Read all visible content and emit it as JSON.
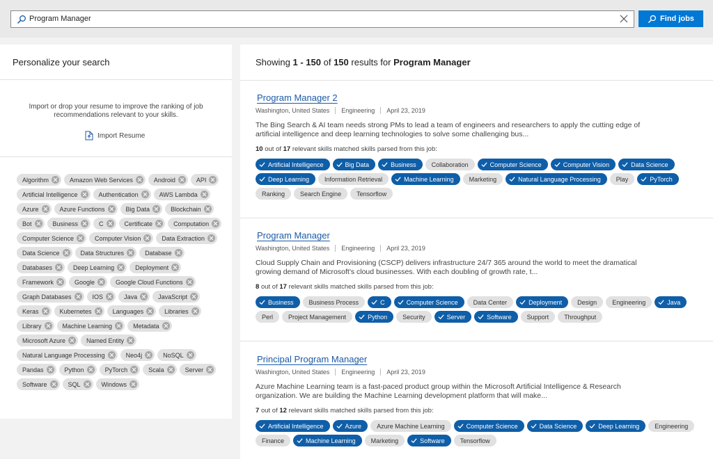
{
  "search": {
    "query": "Program Manager",
    "button_label": "Find jobs"
  },
  "left_panel": {
    "title": "Personalize your search",
    "import_message": "Import or drop your resume to improve the ranking of job recommendations relevant to your skills.",
    "import_label": "Import Resume",
    "skills": [
      "Algorithm",
      "Amazon Web Services",
      "Android",
      "API",
      "Artificial Intelligence",
      "Authentication",
      "AWS Lambda",
      "Azure",
      "Azure Functions",
      "Big Data",
      "Blockchain",
      "Bot",
      "Business",
      "C",
      "Certificate",
      "Computation",
      "Computer Science",
      "Computer Vision",
      "Data Extraction",
      "Data Science",
      "Data Structures",
      "Database",
      "Databases",
      "Deep Learning",
      "Deployment",
      "Framework",
      "Google",
      "Google Cloud Functions",
      "Graph Databases",
      "IOS",
      "Java",
      "JavaScript",
      "Keras",
      "Kubernetes",
      "Languages",
      "Libraries",
      "Library",
      "Machine Learning",
      "Metadata",
      "Microsoft Azure",
      "Named Entity",
      "Natural Language Processing",
      "Neo4j",
      "NoSQL",
      "Pandas",
      "Python",
      "PyTorch",
      "Scala",
      "Server",
      "Software",
      "SQL",
      "Windows"
    ]
  },
  "results": {
    "prefix": "Showing",
    "range": "1 - 150",
    "of": "of",
    "total": "150",
    "results_for": "results for",
    "query": "Program Manager"
  },
  "jobs": [
    {
      "title": "Program Manager 2",
      "location": "Washington, United States",
      "category": "Engineering",
      "date": "April 23, 2019",
      "description": "The Bing Search & AI team needs strong PMs to lead a team of engineers and researchers to apply the cutting edge of artificial intelligence and deep learning technologies to solve some challenging bus...",
      "matched": "10",
      "out_of": "out of",
      "total": "17",
      "matched_suffix": "relevant skills matched skills parsed from this job:",
      "skills": [
        {
          "label": "Artificial Intelligence",
          "matched": true
        },
        {
          "label": "Big Data",
          "matched": true
        },
        {
          "label": "Business",
          "matched": true
        },
        {
          "label": "Collaboration",
          "matched": false
        },
        {
          "label": "Computer Science",
          "matched": true
        },
        {
          "label": "Computer Vision",
          "matched": true
        },
        {
          "label": "Data Science",
          "matched": true
        },
        {
          "label": "Deep Learning",
          "matched": true
        },
        {
          "label": "Information Retrieval",
          "matched": false
        },
        {
          "label": "Machine Learning",
          "matched": true
        },
        {
          "label": "Marketing",
          "matched": false
        },
        {
          "label": "Natural Language Processing",
          "matched": true
        },
        {
          "label": "Play",
          "matched": false
        },
        {
          "label": "PyTorch",
          "matched": true
        },
        {
          "label": "Ranking",
          "matched": false
        },
        {
          "label": "Search Engine",
          "matched": false
        },
        {
          "label": "Tensorflow",
          "matched": false
        }
      ]
    },
    {
      "title": "Program Manager",
      "location": "Washington, United States",
      "category": "Engineering",
      "date": "April 23, 2019",
      "description": "Cloud Supply Chain and Provisioning (CSCP) delivers infrastructure 24/7 365 around the world to meet the dramatical growing demand of Microsoft's cloud businesses. With each doubling of growth rate, t...",
      "matched": "8",
      "out_of": "out of",
      "total": "17",
      "matched_suffix": "relevant skills matched skills parsed from this job:",
      "skills": [
        {
          "label": "Business",
          "matched": true
        },
        {
          "label": "Business Process",
          "matched": false
        },
        {
          "label": "C",
          "matched": true
        },
        {
          "label": "Computer Science",
          "matched": true
        },
        {
          "label": "Data Center",
          "matched": false
        },
        {
          "label": "Deployment",
          "matched": true
        },
        {
          "label": "Design",
          "matched": false
        },
        {
          "label": "Engineering",
          "matched": false
        },
        {
          "label": "Java",
          "matched": true
        },
        {
          "label": "Perl",
          "matched": false
        },
        {
          "label": "Project Management",
          "matched": false
        },
        {
          "label": "Python",
          "matched": true
        },
        {
          "label": "Security",
          "matched": false
        },
        {
          "label": "Server",
          "matched": true
        },
        {
          "label": "Software",
          "matched": true
        },
        {
          "label": "Support",
          "matched": false
        },
        {
          "label": "Throughput",
          "matched": false
        }
      ]
    },
    {
      "title": "Principal Program Manager",
      "location": "Washington, United States",
      "category": "Engineering",
      "date": "April 23, 2019",
      "description": "Azure Machine Learning team is a fast-paced product group within the Microsoft Artificial Intelligence & Research organization. We are building the Machine Learning development platform that will make...",
      "matched": "7",
      "out_of": "out of",
      "total": "12",
      "matched_suffix": "relevant skills matched skills parsed from this job:",
      "skills": [
        {
          "label": "Artificial Intelligence",
          "matched": true
        },
        {
          "label": "Azure",
          "matched": true
        },
        {
          "label": "Azure Machine Learning",
          "matched": false
        },
        {
          "label": "Computer Science",
          "matched": true
        },
        {
          "label": "Data Science",
          "matched": true
        },
        {
          "label": "Deep Learning",
          "matched": true
        },
        {
          "label": "Engineering",
          "matched": false
        },
        {
          "label": "Finance",
          "matched": false
        },
        {
          "label": "Machine Learning",
          "matched": true
        },
        {
          "label": "Marketing",
          "matched": false
        },
        {
          "label": "Software",
          "matched": true
        },
        {
          "label": "Tensorflow",
          "matched": false
        }
      ]
    }
  ],
  "colors": {
    "accent": "#0078d4",
    "tag_on": "#0f5ea8",
    "link": "#1a5aa6"
  }
}
